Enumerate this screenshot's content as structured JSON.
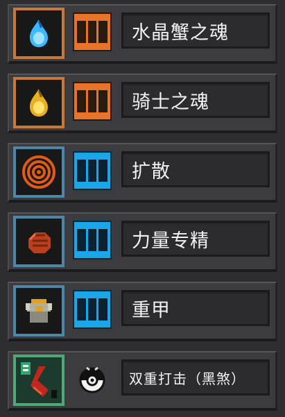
{
  "skills": [
    {
      "name": "水晶蟹之魂",
      "icon": "blue-flame-icon",
      "frame_color": "#c8783a",
      "level": 3
    },
    {
      "name": "骑士之魂",
      "icon": "gold-flame-icon",
      "frame_color": "#c8783a",
      "level": 3
    },
    {
      "name": "扩散",
      "icon": "ripple-rings-icon",
      "frame_color": "#4e86a8",
      "level": 3
    },
    {
      "name": "力量专精",
      "icon": "fist-icon",
      "frame_color": "#4e86a8",
      "level": 3
    },
    {
      "name": "重甲",
      "icon": "armor-icon",
      "frame_color": "#4e86a8",
      "level": 3
    },
    {
      "name": "双重打击（黑煞）",
      "icon": "double-strike-icon",
      "frame_color": "#4ea878",
      "secondary_icon": "black-white-ball-icon"
    }
  ]
}
